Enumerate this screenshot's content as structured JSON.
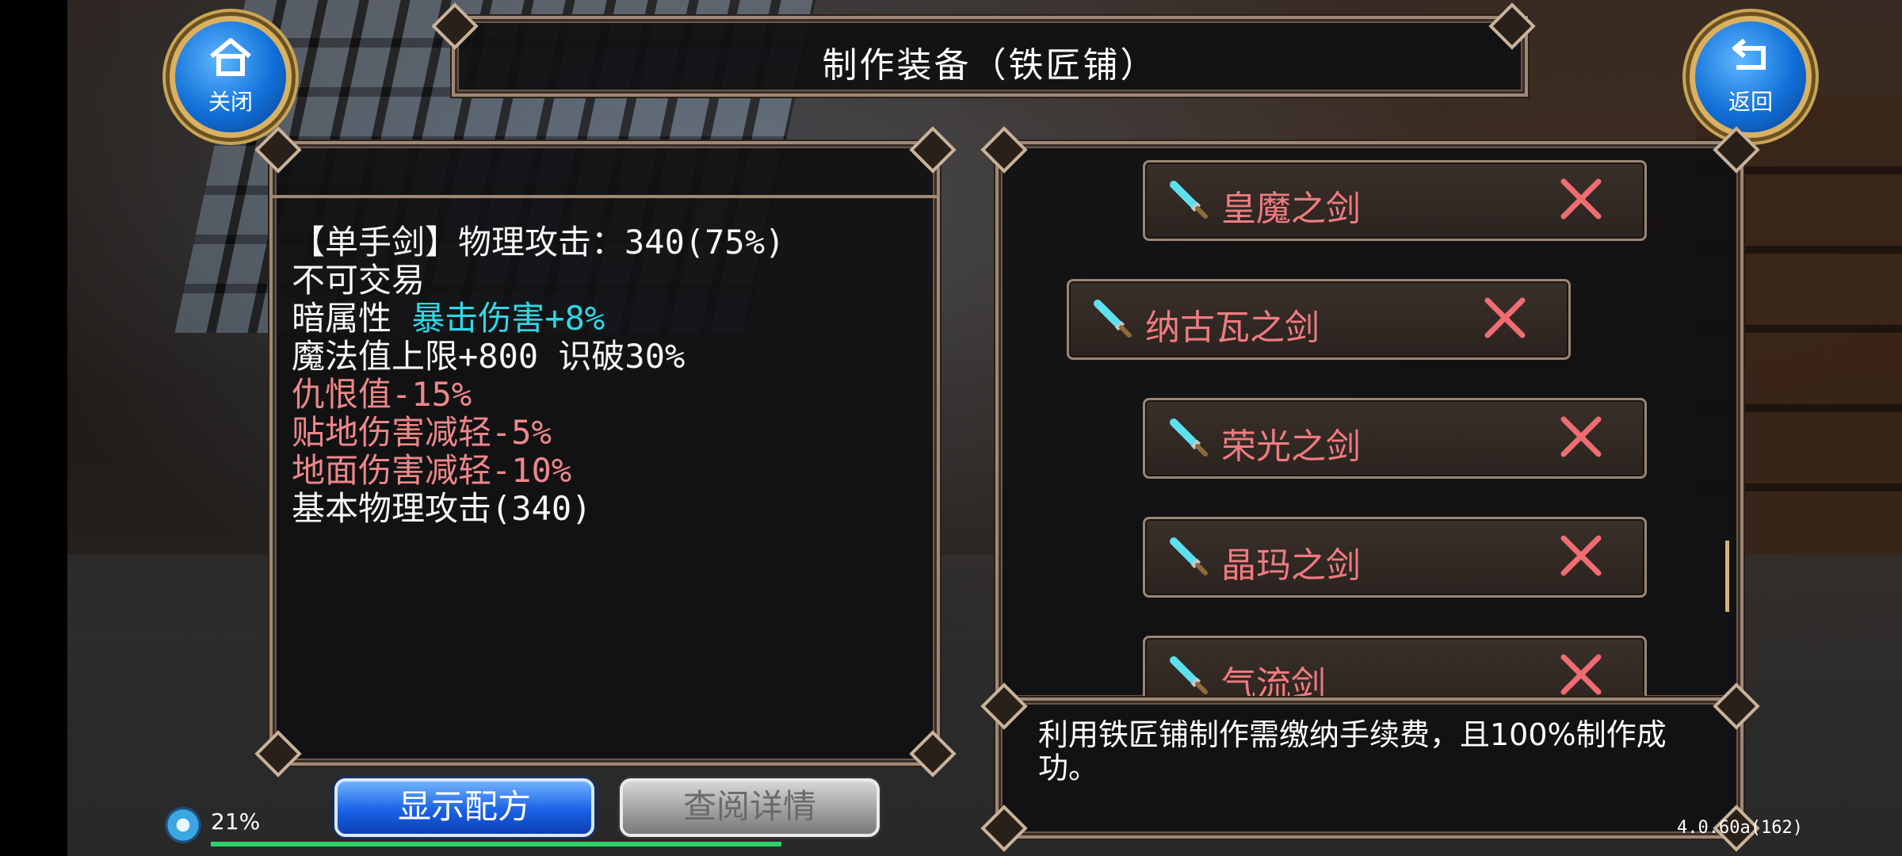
{
  "title": "制作装备（铁匠铺）",
  "close_button": {
    "label": "关闭",
    "icon": "home-icon"
  },
  "back_button": {
    "label": "返回",
    "icon": "return-arrow-icon"
  },
  "item_stats": [
    {
      "text": "【单手剑】物理攻击：340(75%)",
      "color": "white"
    },
    {
      "text": "不可交易",
      "color": "white"
    },
    {
      "prefix": "暗属性 ",
      "highlight": "暴击伤害+8%"
    },
    {
      "text": "魔法值上限+800 识破30%",
      "color": "white"
    },
    {
      "text": "仇恨值-15%",
      "color": "red"
    },
    {
      "text": "贴地伤害减轻-5%",
      "color": "red"
    },
    {
      "text": "地面伤害减轻-10%",
      "color": "red"
    },
    {
      "text": "基本物理攻击(340)",
      "color": "white"
    }
  ],
  "recipe_list": [
    {
      "name": "皇魔之剑",
      "icon": "sword-icon",
      "status_icon": "x-icon"
    },
    {
      "name": "纳古瓦之剑",
      "icon": "sword-icon",
      "status_icon": "x-icon",
      "selected": true
    },
    {
      "name": "荣光之剑",
      "icon": "sword-icon",
      "status_icon": "x-icon"
    },
    {
      "name": "晶玛之剑",
      "icon": "sword-icon",
      "status_icon": "x-icon"
    },
    {
      "name": "气流剑",
      "icon": "sword-icon",
      "status_icon": "x-icon"
    }
  ],
  "info_text": "利用铁匠铺制作需缴纳手续费，且100%制作成功。",
  "buttons": {
    "show_recipe": "显示配方",
    "view_details": "查阅详情"
  },
  "status": {
    "exp_percent": "21%"
  },
  "version": "4.0.60a(162)",
  "colors": {
    "stat_red": "#ee8789",
    "stat_cyan": "#2fd8e6",
    "item_name": "#ef7b80",
    "button_blue": "#1a62e6"
  }
}
